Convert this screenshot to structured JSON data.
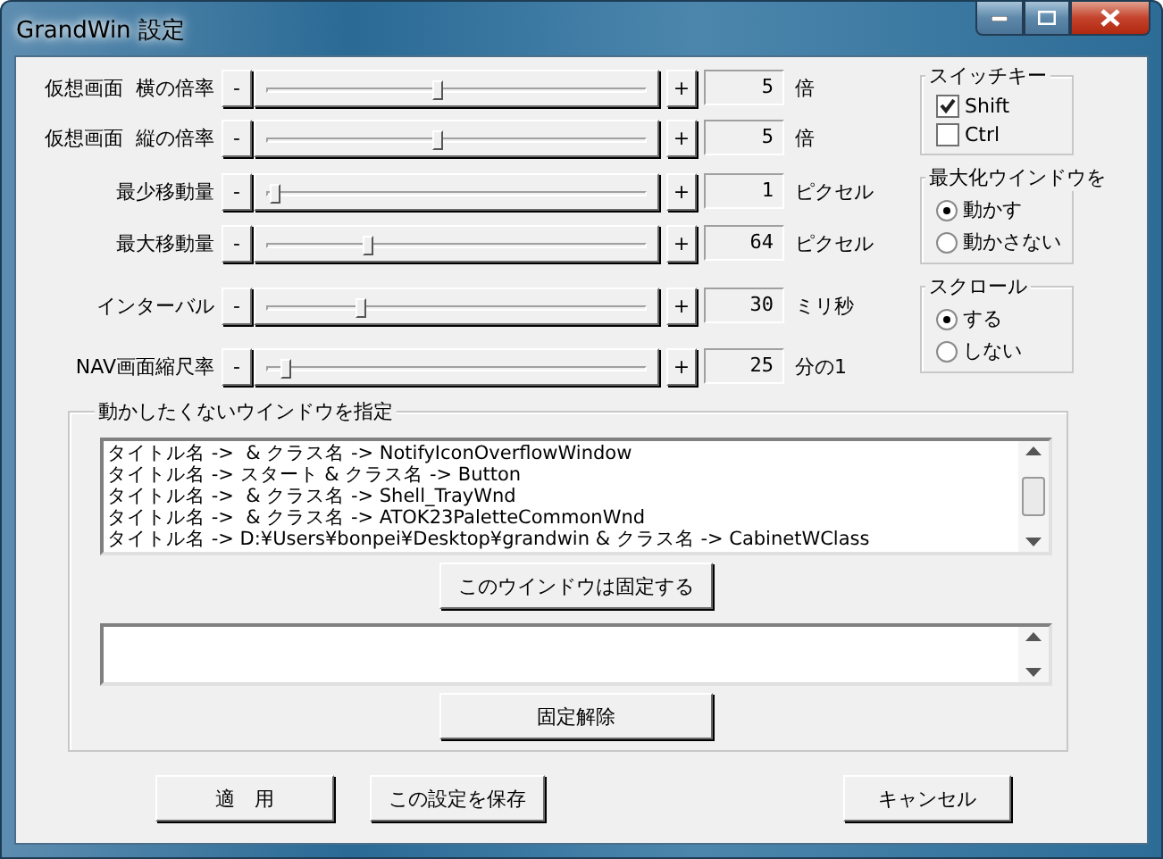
{
  "window": {
    "title": "GrandWin 設定"
  },
  "sliders": [
    {
      "label": "仮想画面  横の倍率",
      "minus": "-",
      "plus": "+",
      "level": 0.45,
      "value": "5",
      "unit": "倍"
    },
    {
      "label": "仮想画面  縦の倍率",
      "minus": "-",
      "plus": "+",
      "level": 0.45,
      "value": "5",
      "unit": "倍"
    },
    {
      "label": "最少移動量",
      "minus": "-",
      "plus": "+",
      "level": 0.01,
      "value": "1",
      "unit": "ピクセル"
    },
    {
      "label": "最大移動量",
      "minus": "-",
      "plus": "+",
      "level": 0.26,
      "value": "64",
      "unit": "ピクセル"
    },
    {
      "label": "インターバル",
      "minus": "-",
      "plus": "+",
      "level": 0.24,
      "value": "30",
      "unit": "ミリ秒"
    },
    {
      "label": "NAV画面縮尺率",
      "minus": "-",
      "plus": "+",
      "level": 0.04,
      "value": "25",
      "unit": "分の1"
    }
  ],
  "switch_key": {
    "title": "スイッチキー",
    "options": [
      {
        "label": "Shift",
        "checked": true
      },
      {
        "label": "Ctrl",
        "checked": false
      }
    ]
  },
  "maximized_window": {
    "title": "最大化ウインドウを",
    "options": [
      {
        "label": "動かす",
        "selected": true
      },
      {
        "label": "動かさない",
        "selected": false
      }
    ]
  },
  "scroll": {
    "title": "スクロール",
    "options": [
      {
        "label": "する",
        "selected": true
      },
      {
        "label": "しない",
        "selected": false
      }
    ]
  },
  "excluded_windows": {
    "title": "動かしたくないウインドウを指定",
    "list": [
      "タイトル名 ->  & クラス名 -> NotifyIconOverflowWindow",
      "タイトル名 -> スタート & クラス名 -> Button",
      "タイトル名 ->  & クラス名 -> Shell_TrayWnd",
      "タイトル名 ->  & クラス名 -> ATOK23PaletteCommonWnd",
      "タイトル名 -> D:¥Users¥bonpei¥Desktop¥grandwin & クラス名 -> CabinetWClass"
    ],
    "fix_button": "このウインドウは固定する",
    "unfix_button": "固定解除"
  },
  "buttons": [
    {
      "label": "適　用"
    },
    {
      "label": "この設定を保存"
    },
    {
      "label": "キャンセル"
    }
  ]
}
